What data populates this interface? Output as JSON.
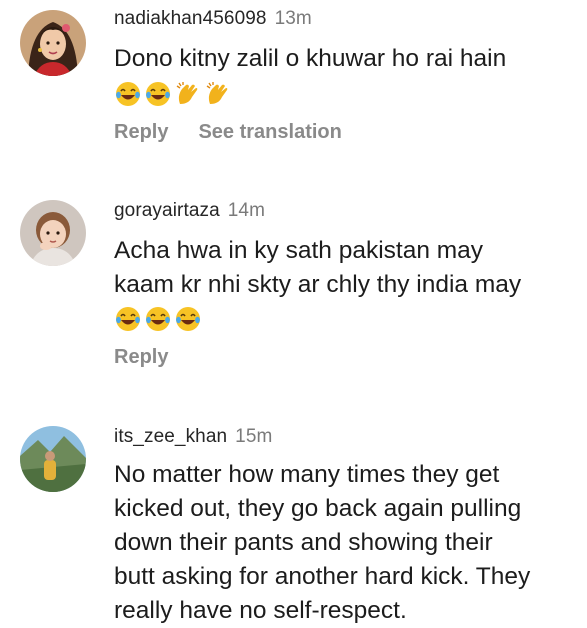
{
  "comments": [
    {
      "username": "nadiakhan456098",
      "time": "13m",
      "lines": [
        "Dono kitny zalil o khuwar ho rai hain"
      ],
      "emojis": [
        "tears-of-joy-icon",
        "tears-of-joy-icon",
        "clapping-hands-icon",
        "clapping-hands-icon"
      ],
      "reply_label": "Reply",
      "translate_label": "See translation"
    },
    {
      "username": "gorayairtaza",
      "time": "14m",
      "lines": [
        "Acha hwa in ky sath pakistan may",
        "kaam kr nhi skty ar chly thy india may"
      ],
      "emojis": [
        "tears-of-joy-icon",
        "tears-of-joy-icon",
        "tears-of-joy-icon"
      ],
      "reply_label": "Reply"
    },
    {
      "username": "its_zee_khan",
      "time": "15m",
      "lines": [
        "No matter how many times they get",
        "kicked out, they go back again pulling",
        "down their pants and showing their",
        "butt asking for another hard kick. They",
        "really have no self-respect."
      ]
    }
  ],
  "colors": {
    "username": "#262626",
    "time": "#7a7a7a",
    "action": "#8a8a8a",
    "emoji_face": "#f7c325"
  }
}
